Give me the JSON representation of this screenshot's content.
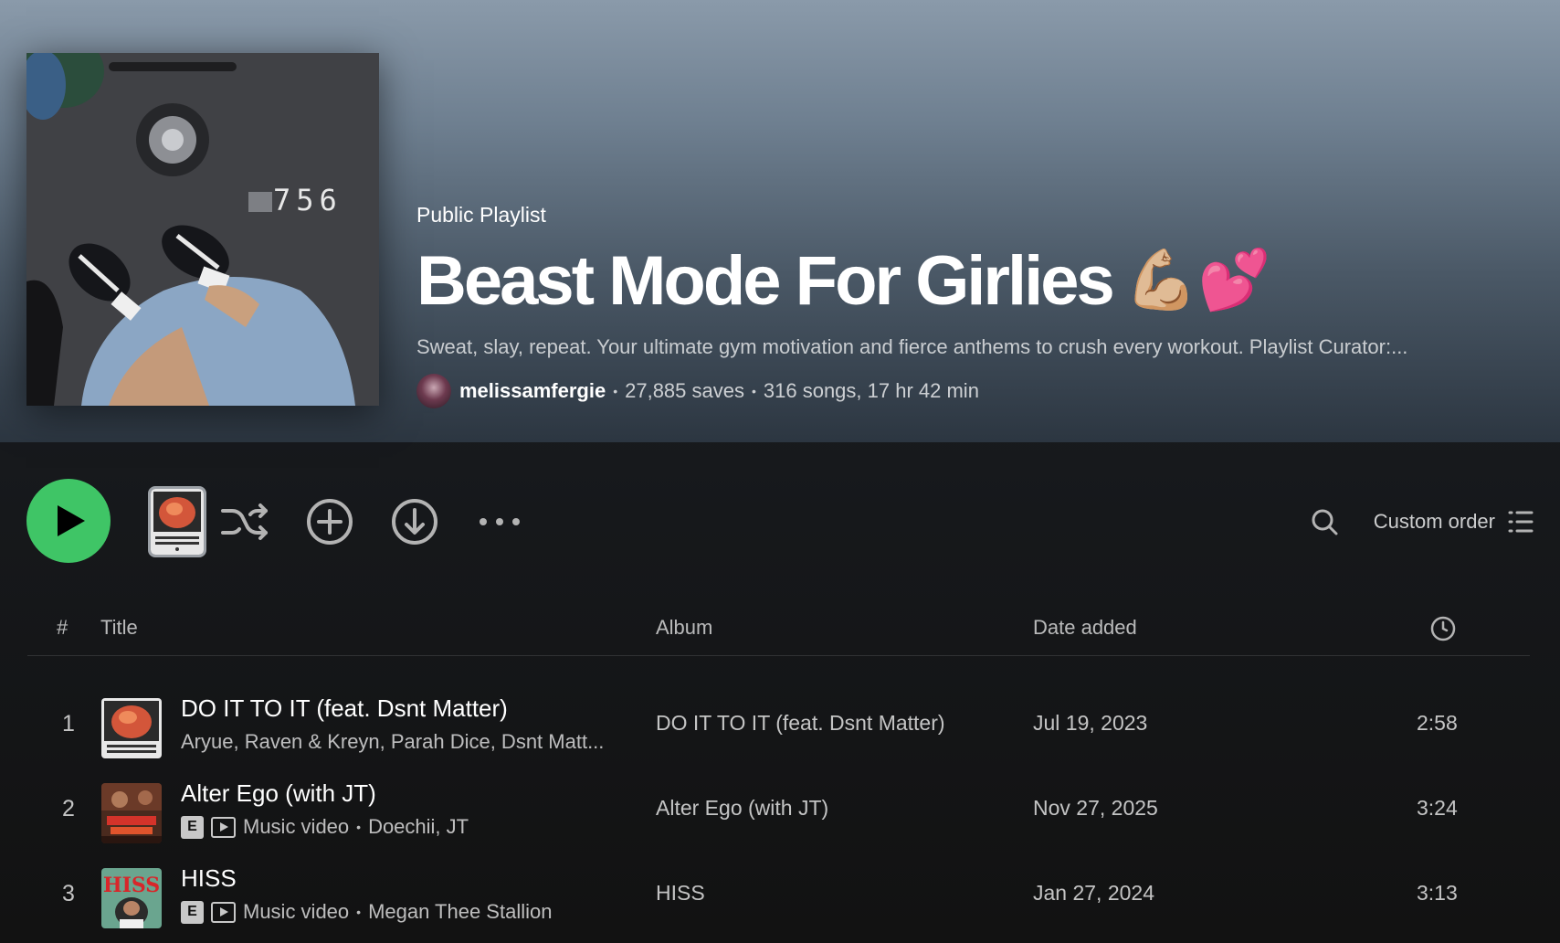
{
  "header": {
    "kind": "Public Playlist",
    "title": "Beast Mode For Girlies",
    "title_emoji_arm": "💪🏼",
    "title_emoji_hearts": "💕",
    "description": "Sweat, slay, repeat. Your ultimate gym motivation and fierce anthems to crush every workout. Playlist Curator:...",
    "owner": "melissamfergie",
    "saves": "27,885 saves",
    "summary": "316 songs, 17 hr 42 min",
    "cover_counter": "756"
  },
  "actions": {
    "play_icon": "play-icon",
    "shuffle_icon": "shuffle-icon",
    "add_icon": "plus-circle-icon",
    "download_icon": "download-icon",
    "more_icon": "more-horizontal-icon",
    "search_icon": "search-icon",
    "sort_label": "Custom order",
    "list_icon": "list-view-icon",
    "accent_color": "#3fc566"
  },
  "table": {
    "columns": {
      "num": "#",
      "title": "Title",
      "album": "Album",
      "date": "Date added",
      "duration_icon": "clock-icon"
    },
    "rows": [
      {
        "num": "1",
        "title": "DO IT TO IT (feat. Dsnt Matter)",
        "artists": "Aryue, Raven & Kreyn, Parah Dice, Dsnt Matt...",
        "explicit": false,
        "music_video": false,
        "album": "DO IT TO IT (feat. Dsnt Matter)",
        "date": "Jul 19, 2023",
        "duration": "2:58"
      },
      {
        "num": "2",
        "title": "Alter Ego (with JT)",
        "explicit_label": "E",
        "video_label": "Music video",
        "artists": "Doechii, JT",
        "album": "Alter Ego (with JT)",
        "date": "Nov 27, 2025",
        "duration": "3:24"
      },
      {
        "num": "3",
        "title": "HISS",
        "explicit_label": "E",
        "video_label": "Music video",
        "artists": "Megan Thee Stallion",
        "album": "HISS",
        "date": "Jan 27, 2024",
        "duration": "3:13",
        "art_text": "HISS"
      }
    ]
  }
}
